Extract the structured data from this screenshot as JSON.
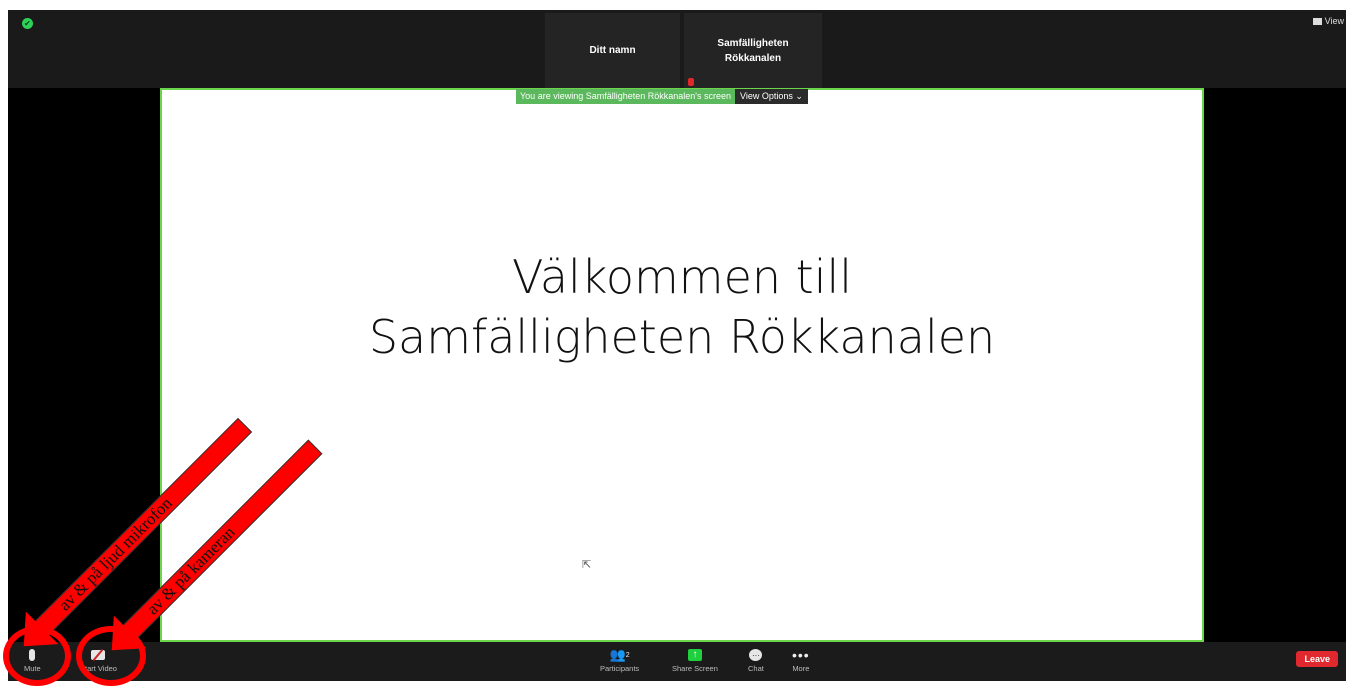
{
  "participants": {
    "tile_1": "Ditt namn",
    "tile_2": "Samfälligheten Rökkanalen"
  },
  "header": {
    "view_label": "View"
  },
  "share_bar": {
    "message": "You are viewing Samfälligheten Rökkanalen's screen",
    "options_label": "View Options ⌄"
  },
  "slide": {
    "line1": "Välkommen till",
    "line2": "Samfälligheten Rökkanalen"
  },
  "toolbar": {
    "mute": "Mute",
    "start_video": "Start Video",
    "participants": "Participants",
    "participants_count": "2",
    "share_screen": "Share Screen",
    "chat": "Chat",
    "more": "More",
    "leave": "Leave"
  },
  "annotations": {
    "mic_arrow": "av & på ljud mikrofon",
    "camera_arrow": "av & på kameran"
  },
  "colors": {
    "accent_green": "#5cb85c",
    "leave_red": "#e0282e",
    "annotation_red": "#ff0000"
  }
}
